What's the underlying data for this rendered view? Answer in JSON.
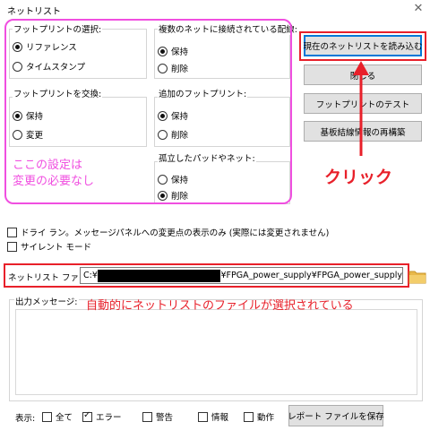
{
  "window": {
    "title": "ネットリスト",
    "close_glyph": "✕"
  },
  "groups": {
    "footprint_select": {
      "label": "フットプリントの選択:",
      "options": [
        {
          "label": "リファレンス",
          "selected": true
        },
        {
          "label": "タイムスタンプ",
          "selected": false
        }
      ]
    },
    "multi_net": {
      "label": "複数のネットに接続されている配線:",
      "options": [
        {
          "label": "保持",
          "selected": true
        },
        {
          "label": "削除",
          "selected": false
        }
      ]
    },
    "footprint_swap": {
      "label": "フットプリントを交換:",
      "options": [
        {
          "label": "保持",
          "selected": true
        },
        {
          "label": "変更",
          "selected": false
        }
      ]
    },
    "extra_footprint": {
      "label": "追加のフットプリント:",
      "options": [
        {
          "label": "保持",
          "selected": true
        },
        {
          "label": "削除",
          "selected": false
        }
      ]
    },
    "isolated_pad": {
      "label": "孤立したパッドやネット:",
      "options": [
        {
          "label": "保持",
          "selected": false
        },
        {
          "label": "削除",
          "selected": true
        }
      ]
    }
  },
  "buttons": {
    "read_netlist": "現在のネットリストを読み込む",
    "close": "閉じる",
    "test_footprint": "フットプリントのテスト",
    "rebuild_connectivity": "基板結線情報の再構築",
    "save_report": "レポート ファイルを保存"
  },
  "checks": {
    "dry_run": {
      "label": "ドライ ラン。メッセージパネルへの変更点の表示のみ (実際には変更されません)",
      "checked": false
    },
    "silent_mode": {
      "label": "サイレント モード",
      "checked": false
    }
  },
  "netlist_file": {
    "label": "ネットリスト ファイル:",
    "value_prefix": "C:¥",
    "value_suffix": "¥FPGA_power_supply¥FPGA_power_supply"
  },
  "output": {
    "label": "出力メッセージ:"
  },
  "filters": {
    "label": "表示:",
    "items": [
      {
        "label": "全て",
        "checked": false
      },
      {
        "label": "エラー",
        "checked": true
      },
      {
        "label": "警告",
        "checked": false
      },
      {
        "label": "情報",
        "checked": false
      },
      {
        "label": "動作",
        "checked": false
      }
    ]
  },
  "annotations": {
    "no_change_line1": "ここの設定は",
    "no_change_line2": "変更の必要なし",
    "click": "クリック",
    "auto_selected": "自動的にネットリストのファイルが選択されている",
    "pink_color": "#f04fe0",
    "red_color": "#e8202a"
  }
}
